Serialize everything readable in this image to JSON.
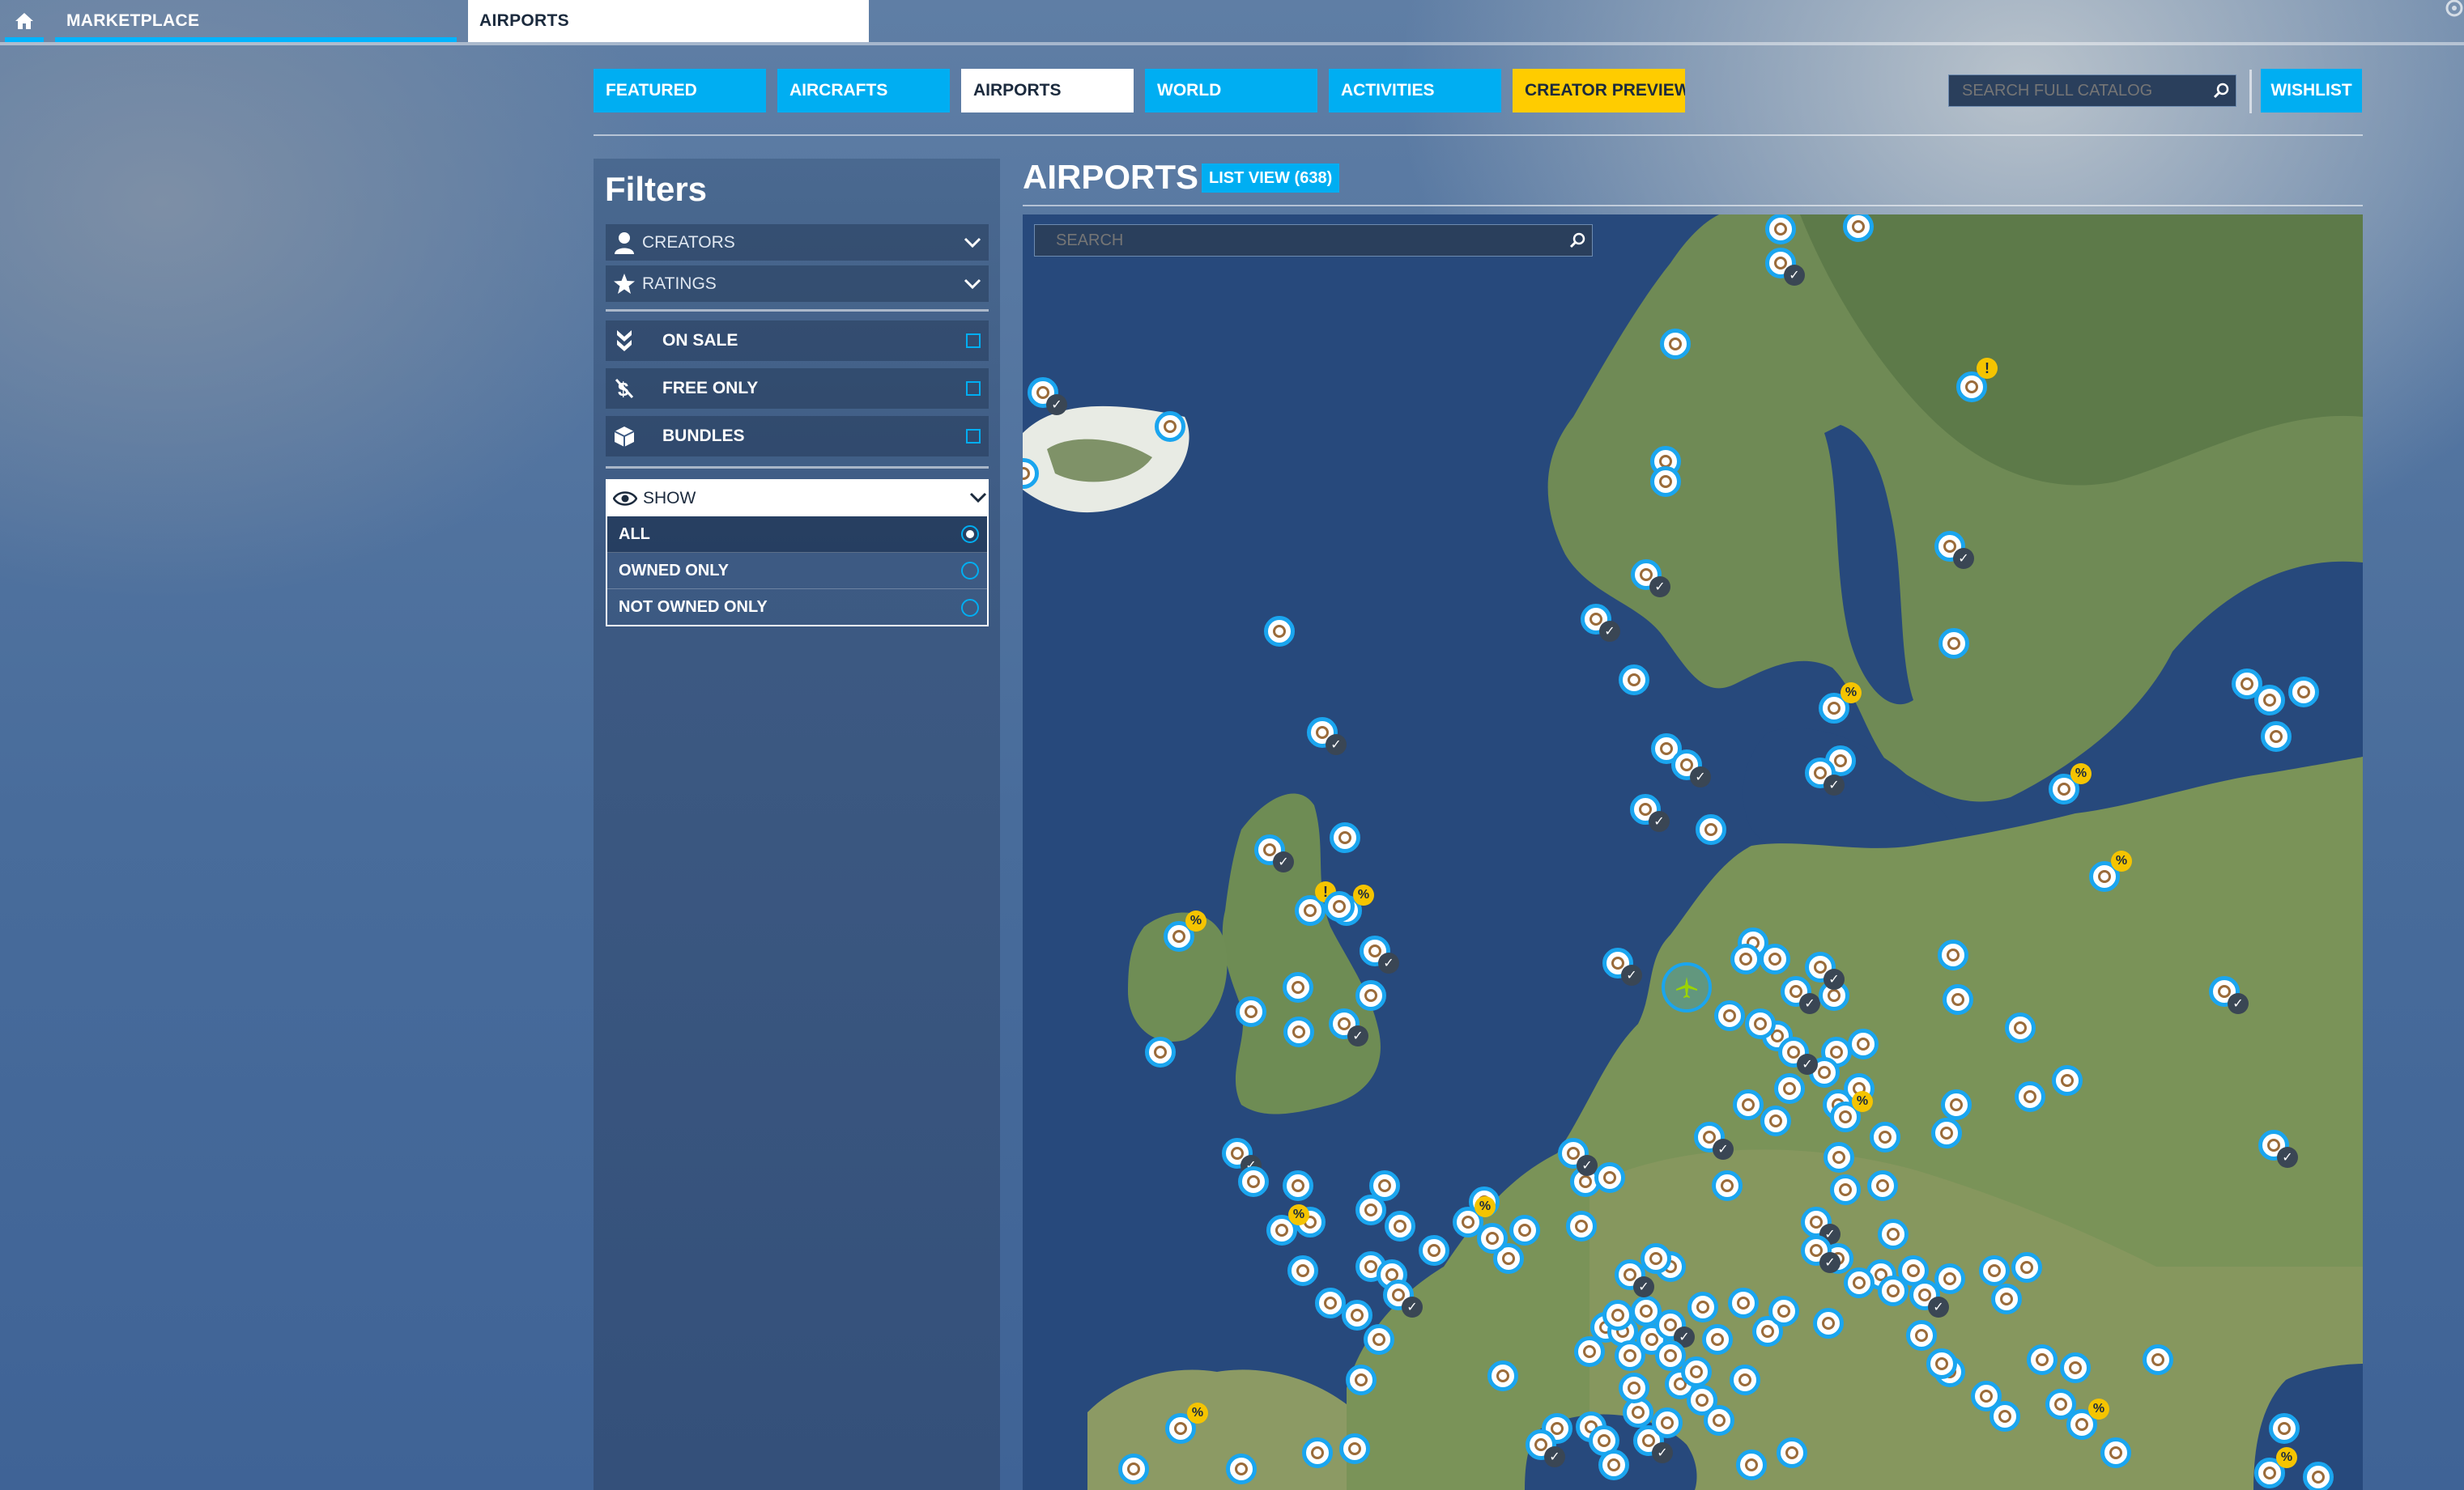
{
  "topbar": {
    "home_icon": "home-icon",
    "marketplace_label": "MARKETPLACE",
    "airports_tab_label": "AIRPORTS"
  },
  "nav": {
    "items": [
      {
        "label": "FEATURED"
      },
      {
        "label": "AIRCRAFTS"
      },
      {
        "label": "AIRPORTS"
      },
      {
        "label": "WORLD"
      },
      {
        "label": "ACTIVITIES"
      },
      {
        "label": "CREATOR PREVIEW"
      }
    ],
    "search_placeholder": "SEARCH FULL CATALOG",
    "wishlist_label": "WISHLIST"
  },
  "filters": {
    "title": "Filters",
    "dropdowns": [
      {
        "label": "CREATORS",
        "icon": "user-icon"
      },
      {
        "label": "RATINGS",
        "icon": "star-icon"
      }
    ],
    "checkboxes": [
      {
        "label": "ON SALE",
        "icon": "sale-tag-icon",
        "checked": false
      },
      {
        "label": "FREE ONLY",
        "icon": "free-icon",
        "checked": false
      },
      {
        "label": "BUNDLES",
        "icon": "bundle-icon",
        "checked": false
      }
    ],
    "show": {
      "label": "SHOW",
      "options": [
        {
          "label": "ALL",
          "selected": true
        },
        {
          "label": "OWNED ONLY",
          "selected": false
        },
        {
          "label": "NOT OWNED ONLY",
          "selected": false
        }
      ]
    }
  },
  "main": {
    "title": "AIRPORTS",
    "list_view_label": "LIST VIEW (638)",
    "map_search_placeholder": "SEARCH"
  },
  "colors": {
    "accent": "#00aef2",
    "creator_preview": "#ffcc00",
    "sale_badge": "#f5c400",
    "owned_badge": "#3a4654"
  },
  "map_badges": {
    "owned": "✓",
    "sale": "%",
    "warning": "!"
  }
}
